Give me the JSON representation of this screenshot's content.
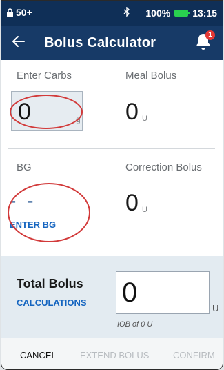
{
  "status_bar": {
    "notification_count": "50+",
    "battery": "100%",
    "time": "13:15"
  },
  "header": {
    "title": "Bolus Calculator",
    "notification_badge": "1"
  },
  "carbs": {
    "label": "Enter Carbs",
    "value": "0",
    "unit": "g"
  },
  "meal_bolus": {
    "label": "Meal Bolus",
    "value": "0",
    "unit": "U"
  },
  "bg": {
    "label": "BG",
    "value": "- -",
    "action": "ENTER BG"
  },
  "correction_bolus": {
    "label": "Correction Bolus",
    "value": "0",
    "unit": "U"
  },
  "total": {
    "label": "Total Bolus",
    "calculations_link": "CALCULATIONS",
    "value": "0",
    "unit": "U",
    "iob": "IOB of 0 U"
  },
  "actions": {
    "cancel": "CANCEL",
    "extend": "EXTEND BOLUS",
    "confirm": "CONFIRM"
  },
  "colors": {
    "status_bar": "#0f2f57",
    "app_bar": "#173a67",
    "link": "#1565c0",
    "annotation_ring": "#d23a3a",
    "total_panel": "#e3ebf1"
  },
  "icons": {
    "status_left": "lock-icon",
    "status_bt": "bluetooth-icon",
    "status_battery": "battery-icon",
    "back": "back-arrow-icon",
    "bell": "bell-icon"
  }
}
